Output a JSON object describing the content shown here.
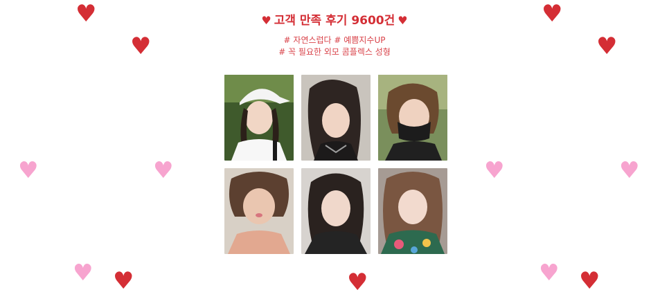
{
  "header": {
    "heart_symbol": "♥",
    "title": "고객 만족 후기 9600건",
    "tags_line1": "# 자연스럽다  # 예쁨지수UP",
    "tags_line2": "# 꼭 필요한 외모 콤플렉스 성형"
  },
  "decor": {
    "red_heart": "♥",
    "pink_heart": "♥",
    "colors": {
      "red": "#d42e35",
      "pink": "#f7a4cf"
    }
  },
  "gallery": {
    "photos": [
      {
        "name": "review-photo-1",
        "desc": "woman with white cap"
      },
      {
        "name": "review-photo-2",
        "desc": "woman with long dark hair, selfie"
      },
      {
        "name": "review-photo-3",
        "desc": "woman with short hair and black mask"
      },
      {
        "name": "review-photo-4",
        "desc": "woman with short hair, pink top"
      },
      {
        "name": "review-photo-5",
        "desc": "woman with dark hair, black top"
      },
      {
        "name": "review-photo-6",
        "desc": "woman with brown hair, floral top"
      }
    ]
  }
}
